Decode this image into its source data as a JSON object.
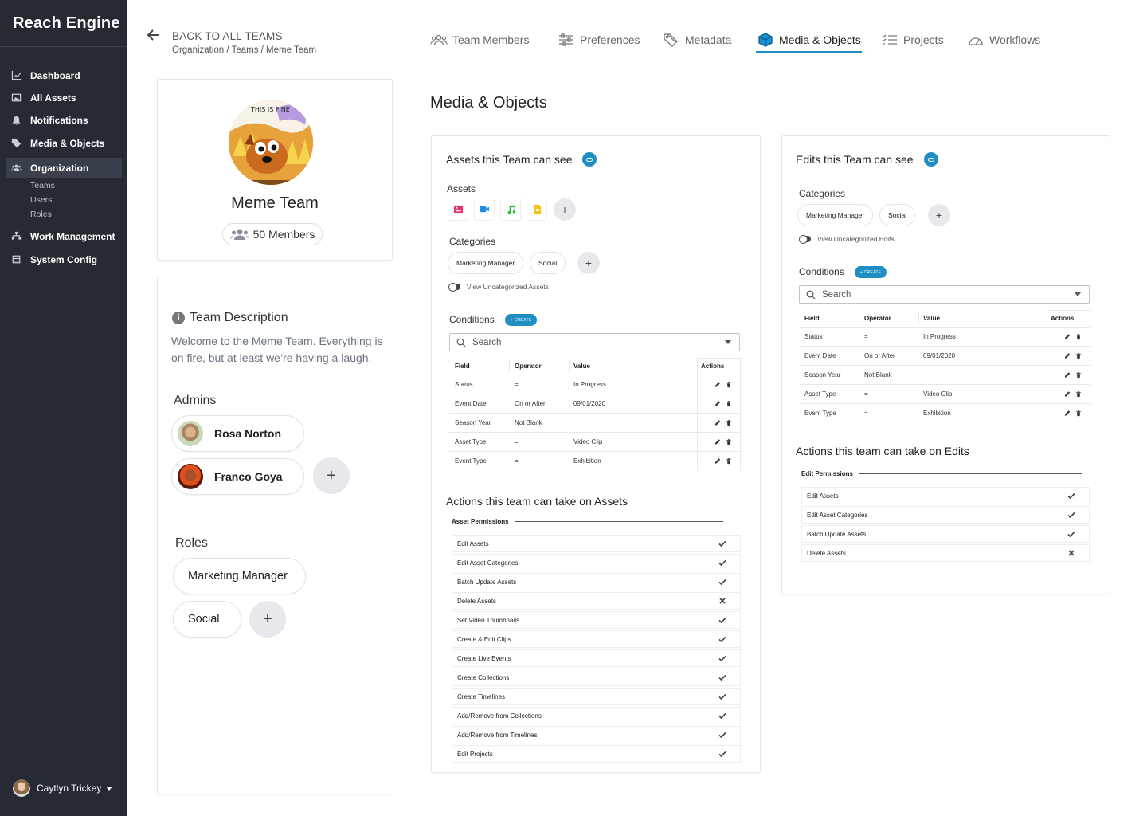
{
  "app": {
    "name": "Reach Engine"
  },
  "sidebar": {
    "items": [
      {
        "label": "Dashboard",
        "icon": "chart-line-icon"
      },
      {
        "label": "All Assets",
        "icon": "image-icon"
      },
      {
        "label": "Notifications",
        "icon": "bell-icon"
      },
      {
        "label": "Media & Objects",
        "icon": "tag-icon"
      },
      {
        "label": "Organization",
        "icon": "users-icon",
        "active": true
      },
      {
        "label": "Work Management",
        "icon": "sitemap-icon"
      },
      {
        "label": "System Config",
        "icon": "config-icon"
      }
    ],
    "sub_items": [
      "Teams",
      "Users",
      "Roles"
    ],
    "user": {
      "name": "Caytlyn Trickey"
    }
  },
  "header": {
    "back_label": "BACK TO ALL TEAMS",
    "breadcrumb": "Organization / Teams / Meme Team",
    "tabs": [
      {
        "label": "Team Members",
        "icon": "team-members-icon"
      },
      {
        "label": "Preferences",
        "icon": "sliders-icon"
      },
      {
        "label": "Metadata",
        "icon": "tags-icon"
      },
      {
        "label": "Media & Objects",
        "icon": "cube-icon",
        "active": true
      },
      {
        "label": "Projects",
        "icon": "checklist-icon"
      },
      {
        "label": "Workflows",
        "icon": "gauge-icon"
      }
    ]
  },
  "team": {
    "avatar_caption": "THIS IS FINE",
    "name": "Meme Team",
    "members": "50 Members",
    "description_title": "Team Description",
    "description": "Welcome to the Meme Team. Everything is on fire, but at least we’re having a laugh.",
    "admins_label": "Admins",
    "admins": [
      "Rosa Norton",
      "Franco Goya"
    ],
    "roles_label": "Roles",
    "roles": [
      "Marketing Manager",
      "Social"
    ]
  },
  "main": {
    "title": "Media & Objects",
    "assets_card": {
      "title": "Assets this Team can see",
      "assets_label": "Assets",
      "asset_types": [
        {
          "icon": "image-icon",
          "color": "#e8336d"
        },
        {
          "icon": "video-icon",
          "color": "#1a8fe3"
        },
        {
          "icon": "audio-icon",
          "color": "#1fba3e"
        },
        {
          "icon": "document-icon",
          "color": "#f2c40f"
        }
      ],
      "categories_label": "Categories",
      "categories": [
        "Marketing Manager",
        "Social"
      ],
      "toggle_label": "View Uncategorized Assets",
      "conditions_label": "Conditions",
      "create_label": "+ CREATE",
      "search_placeholder": "Search",
      "columns": [
        "Field",
        "Operator",
        "Value",
        "Actions"
      ],
      "rows": [
        [
          "Status",
          "=",
          "In Progress"
        ],
        [
          "Event Date",
          "On or After",
          "09/01/2020"
        ],
        [
          "Season Year",
          "Not Blank",
          ""
        ],
        [
          "Asset Type",
          "=",
          "Video Clip"
        ],
        [
          "Event Type",
          "=",
          "Exhibition"
        ]
      ],
      "actions_title": "Actions this team can take on Assets",
      "permissions_group": "Asset Permissions",
      "permissions": [
        {
          "label": "Edit Assets",
          "allowed": true
        },
        {
          "label": "Edit Asset Categories",
          "allowed": true
        },
        {
          "label": "Batch Update Assets",
          "allowed": true
        },
        {
          "label": "Delete Assets",
          "allowed": false
        },
        {
          "label": "Set Video Thumbnails",
          "allowed": true
        },
        {
          "label": "Create & Edit Clips",
          "allowed": true
        },
        {
          "label": "Create Live Events",
          "allowed": true
        },
        {
          "label": "Create Collections",
          "allowed": true
        },
        {
          "label": "Create Timelines",
          "allowed": true
        },
        {
          "label": "Add/Remove from Collections",
          "allowed": true
        },
        {
          "label": "Add/Remove from Timelines",
          "allowed": true
        },
        {
          "label": "Edit Projects",
          "allowed": true
        }
      ]
    },
    "edits_card": {
      "title": "Edits this Team can see",
      "categories_label": "Categories",
      "categories": [
        "Marketing Manager",
        "Social"
      ],
      "toggle_label": "View Uncategorized Edits",
      "conditions_label": "Conditions",
      "create_label": "+ CREATE",
      "search_placeholder": "Search",
      "columns": [
        "Field",
        "Operator",
        "Value",
        "Actions"
      ],
      "rows": [
        [
          "Status",
          "=",
          "In Progress"
        ],
        [
          "Event Date",
          "On or After",
          "09/01/2020"
        ],
        [
          "Season Year",
          "Not Blank",
          ""
        ],
        [
          "Asset Type",
          "=",
          "Video Clip"
        ],
        [
          "Event Type",
          "=",
          "Exhibition"
        ]
      ],
      "actions_title": "Actions this team can take on Edits",
      "permissions_group": "Edit Permissions",
      "permissions": [
        {
          "label": "Edit Assets",
          "allowed": true
        },
        {
          "label": "Edit Asset Categories",
          "allowed": true
        },
        {
          "label": "Batch Update Assets",
          "allowed": true
        },
        {
          "label": "Delete Assets",
          "allowed": false
        }
      ]
    }
  },
  "colors": {
    "sidebar": "#252a33",
    "accent": "#1f8ec2"
  }
}
